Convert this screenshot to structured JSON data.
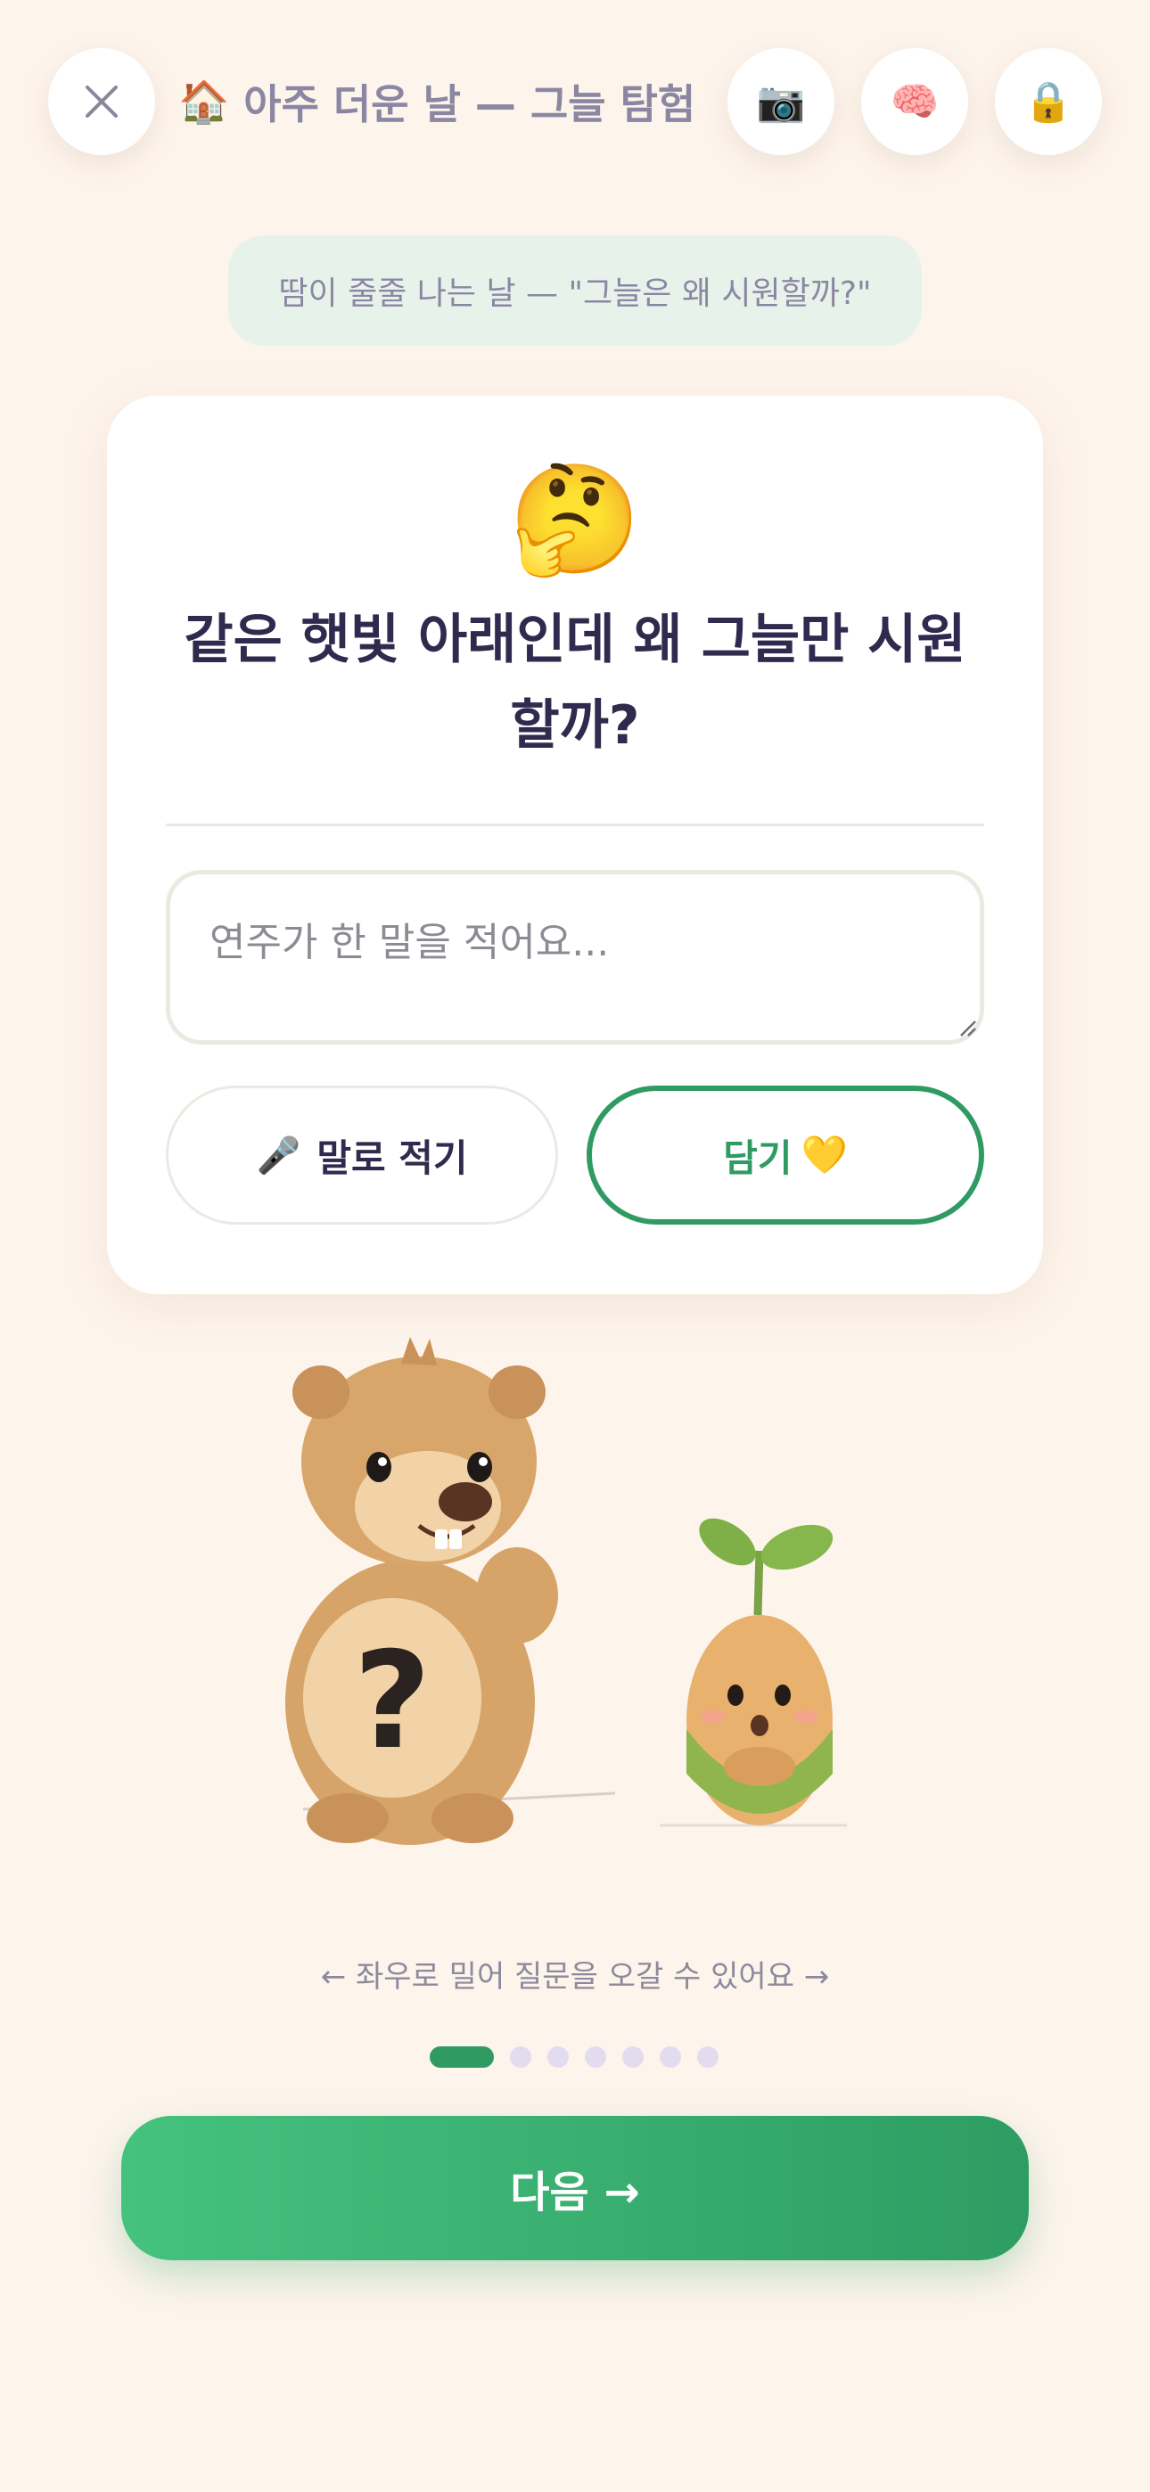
{
  "header": {
    "title_emoji": "🏠",
    "title": "아주 더운 날 — 그늘 탐험",
    "camera_emoji": "📷",
    "brain_emoji": "🧠",
    "lock_emoji": "🔒"
  },
  "subtitle": "땀이 줄줄 나는 날 — \"그늘은 왜 시원할까?\"",
  "card": {
    "emoji": "🤔",
    "question": "같은 햇빛 아래인데 왜 그늘만 시원할까?",
    "answer_placeholder": "연주가 한 말을 적어요...",
    "answer_value": "",
    "voice_button_icon": "🎤",
    "voice_button_label": "말로 적기",
    "save_button_label": "담기",
    "save_button_icon": "💛"
  },
  "swipe_hint": "← 좌우로 밀어 질문을 오갈 수 있어요 →",
  "pagination": {
    "total": 7,
    "current": 1
  },
  "next_button_label": "다음 →",
  "colors": {
    "background": "#fdf4ec",
    "accent_green": "#2f9b63",
    "text_dark": "#2f2b4e",
    "text_muted": "#8b87a3",
    "pill_bg": "#e7f3ea"
  }
}
